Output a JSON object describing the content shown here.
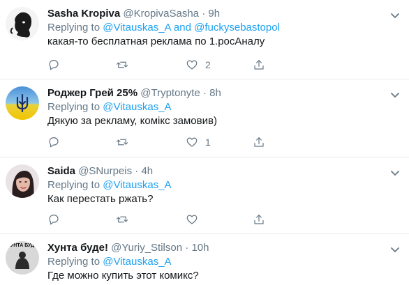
{
  "replying_prefix": "Replying to",
  "tweets": [
    {
      "name": "Sasha Kropiva",
      "handle": "@KropivaSasha",
      "separator": "·",
      "time": "9h",
      "reply_to_a": "@Vitauskas_A",
      "reply_and": "and",
      "reply_to_b": "@fuckysebastopol",
      "text": "какая-то бесплатная реклама по 1.росАналу",
      "like_count": "2",
      "avatar_icon": "bearded-man-silhouette"
    },
    {
      "name": "Роджер Грей 25%",
      "handle": "@Tryptonyte",
      "separator": "·",
      "time": "8h",
      "reply_to_a": "@Vitauskas_A",
      "text": "Дякую за рекламу, комікс замовив)",
      "like_count": "1",
      "avatar_icon": "ukraine-trident-flag"
    },
    {
      "name": "Saida",
      "handle": "@SNurpeis",
      "separator": "·",
      "time": "4h",
      "reply_to_a": "@Vitauskas_A",
      "text": "Как перестать ржать?",
      "like_count": "",
      "avatar_icon": "woman-portrait"
    },
    {
      "name": "Хунта буде!",
      "handle": "@Yuriy_Stilson",
      "separator": "·",
      "time": "10h",
      "reply_to_a": "@Vitauskas_A",
      "text": "Где можно купить этот комикс?",
      "like_count": "",
      "avatar_icon": "khunta-bude-logo",
      "avatar_text": "ХУНТА БУДЕ"
    }
  ],
  "colors": {
    "link": "#1da1f2",
    "muted": "#657786",
    "text": "#14171a",
    "divider": "#e6ecf0"
  }
}
